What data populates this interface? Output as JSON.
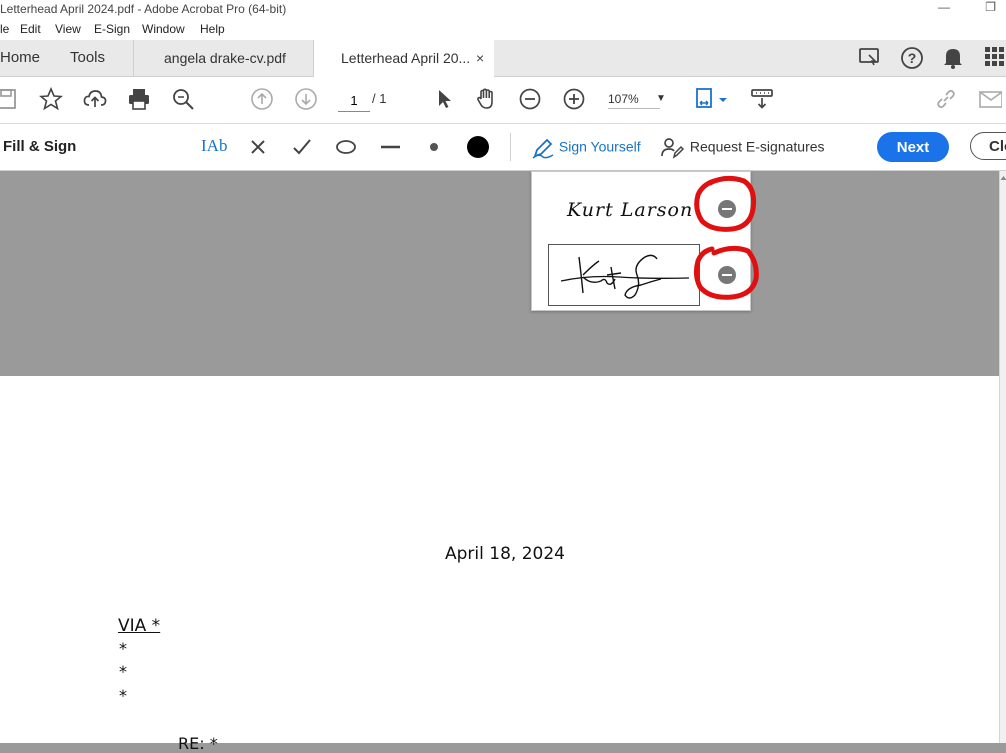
{
  "window": {
    "title": "Letterhead April 2024.pdf - Adobe Acrobat Pro (64-bit)",
    "minimize": "—",
    "restore": "❐"
  },
  "menu": [
    "le",
    "Edit",
    "View",
    "E-Sign",
    "Window",
    "Help"
  ],
  "tabs": {
    "home": "Home",
    "tools": "Tools",
    "doc1": "angela drake-cv.pdf",
    "doc2": "Letterhead April 20...",
    "close": "×"
  },
  "toolbar": {
    "page_current": "1",
    "page_total": "/ 1",
    "zoom": "107%"
  },
  "fill_sign": {
    "title": "Fill & Sign",
    "text_tool": "IAb",
    "sign_yourself": "Sign Yourself",
    "request_esign": "Request E-signatures",
    "next": "Next",
    "close": "Clo"
  },
  "signature_panel": {
    "name_signature": "Kurt Larson",
    "annotation_color": "#e01010"
  },
  "document": {
    "date": "April 18, 2024",
    "via": "VIA *",
    "lines": [
      "*",
      "*",
      "*"
    ],
    "re": "RE:      *"
  }
}
